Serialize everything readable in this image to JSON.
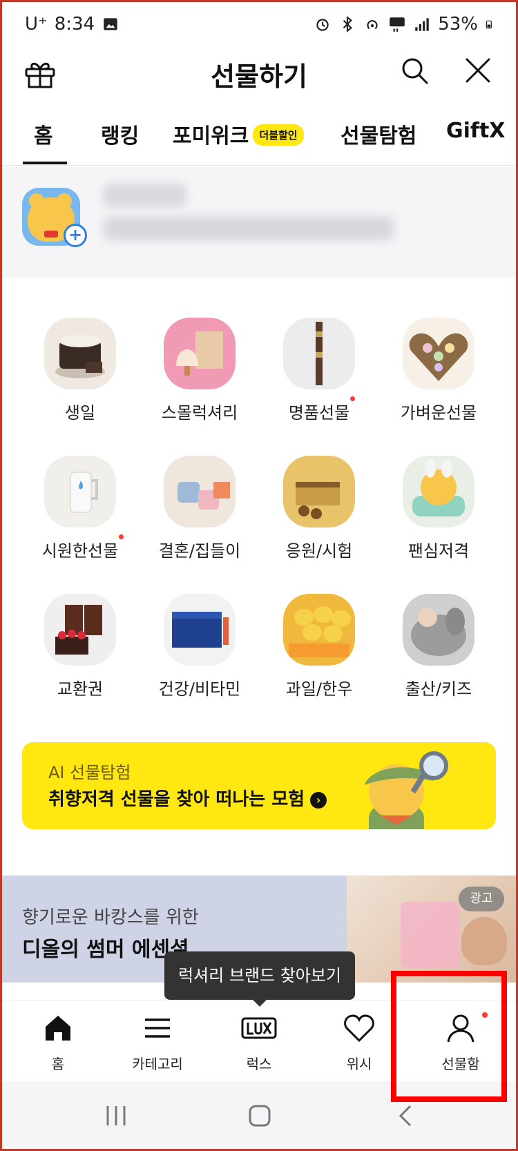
{
  "status_bar": {
    "carrier": "U⁺",
    "time": "8:34",
    "battery": "53%"
  },
  "header": {
    "title": "선물하기"
  },
  "tabs": [
    {
      "label": "홈",
      "active": true
    },
    {
      "label": "랭킹"
    },
    {
      "label": "포미위크",
      "badge": "더블할인"
    },
    {
      "label": "선물탐험"
    },
    {
      "label": "GiftX"
    }
  ],
  "categories": [
    {
      "label": "생일",
      "icon": "cake-icon"
    },
    {
      "label": "스몰럭셔리",
      "icon": "small-luxury-icon"
    },
    {
      "label": "명품선물",
      "icon": "luxury-gift-icon",
      "new_dot": true
    },
    {
      "label": "가벼운선물",
      "icon": "macaron-icon"
    },
    {
      "label": "시원한선물",
      "icon": "tumbler-icon",
      "new_dot": true
    },
    {
      "label": "결혼/집들이",
      "icon": "cups-icon"
    },
    {
      "label": "응원/시험",
      "icon": "chocolate-icon"
    },
    {
      "label": "팬심저격",
      "icon": "character-icon"
    },
    {
      "label": "교환권",
      "icon": "coffee-cake-icon"
    },
    {
      "label": "건강/비타민",
      "icon": "vitamin-icon"
    },
    {
      "label": "과일/한우",
      "icon": "mango-icon"
    },
    {
      "label": "출산/키즈",
      "icon": "baby-icon"
    }
  ],
  "ai_banner": {
    "subtitle": "AI 선물탐험",
    "title": "취향저격 선물을 찾아 떠나는 모험"
  },
  "ad": {
    "subtitle": "향기로운 바캉스를 위한",
    "title": "디올의 썸머 에센셜",
    "badge": "광고"
  },
  "tooltip": "럭셔리 브랜드 찾아보기",
  "bottom_nav": [
    {
      "label": "홈",
      "icon": "home-icon"
    },
    {
      "label": "카테고리",
      "icon": "menu-icon"
    },
    {
      "label": "럭스",
      "icon": "lux-icon"
    },
    {
      "label": "위시",
      "icon": "heart-icon"
    },
    {
      "label": "선물함",
      "icon": "person-icon"
    }
  ],
  "colors": {
    "accent_yellow": "#ffe812",
    "highlight_red": "#ff0000",
    "new_dot": "#ff3b30"
  }
}
